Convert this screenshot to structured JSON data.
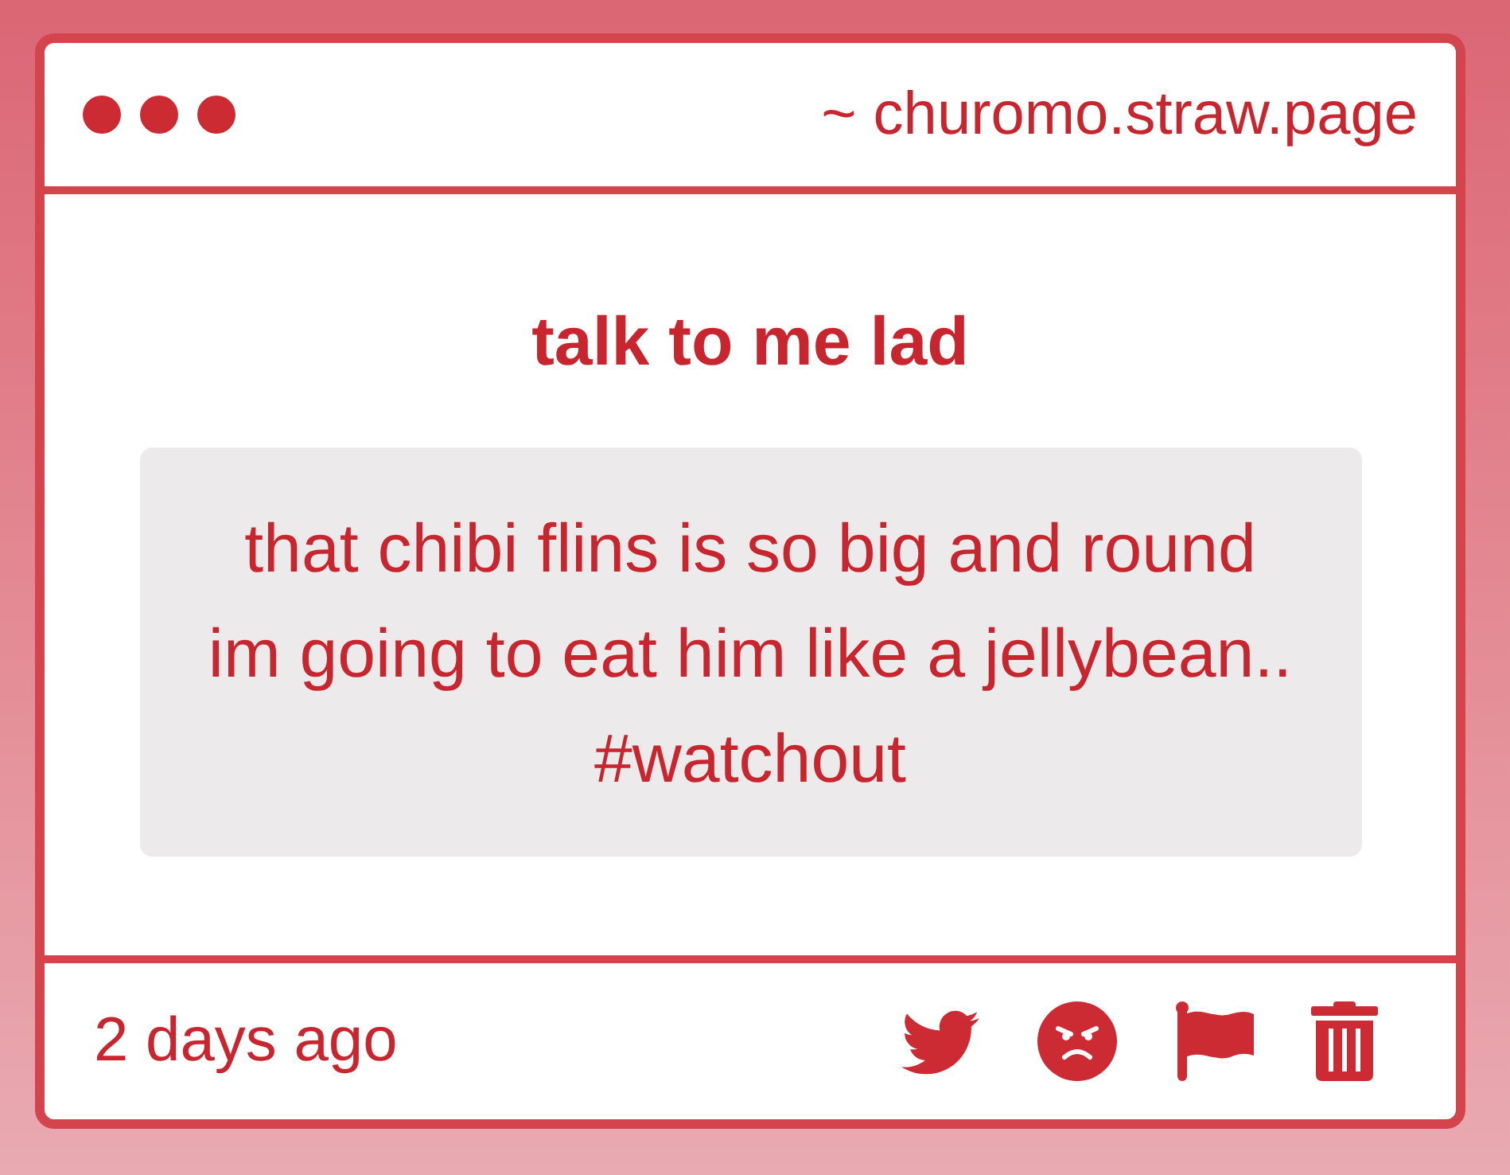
{
  "window": {
    "address": "~ churomo.straw.page"
  },
  "post": {
    "title": "talk to me lad",
    "message": "that chibi flins is so big and round\nim going to eat him like a jellybean..\n#watchout"
  },
  "footer": {
    "time": "2 days ago"
  }
}
